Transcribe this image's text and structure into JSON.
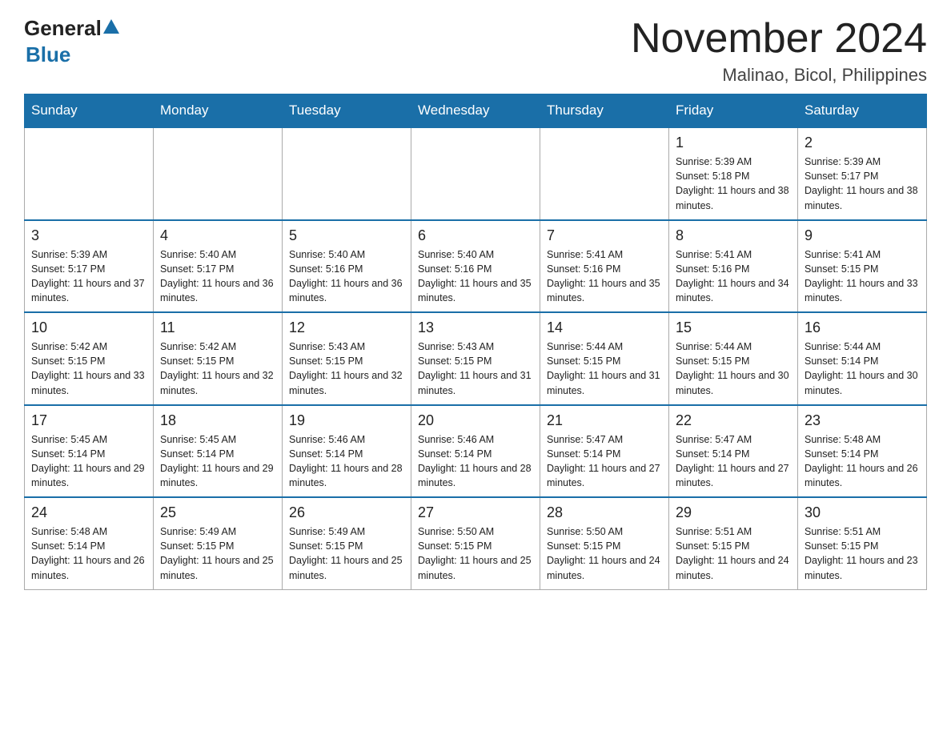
{
  "logo": {
    "general": "General",
    "blue": "Blue"
  },
  "title": "November 2024",
  "location": "Malinao, Bicol, Philippines",
  "days_of_week": [
    "Sunday",
    "Monday",
    "Tuesday",
    "Wednesday",
    "Thursday",
    "Friday",
    "Saturday"
  ],
  "weeks": [
    [
      {
        "day": "",
        "info": "",
        "empty": true
      },
      {
        "day": "",
        "info": "",
        "empty": true
      },
      {
        "day": "",
        "info": "",
        "empty": true
      },
      {
        "day": "",
        "info": "",
        "empty": true
      },
      {
        "day": "",
        "info": "",
        "empty": true
      },
      {
        "day": "1",
        "info": "Sunrise: 5:39 AM\nSunset: 5:18 PM\nDaylight: 11 hours and 38 minutes."
      },
      {
        "day": "2",
        "info": "Sunrise: 5:39 AM\nSunset: 5:17 PM\nDaylight: 11 hours and 38 minutes."
      }
    ],
    [
      {
        "day": "3",
        "info": "Sunrise: 5:39 AM\nSunset: 5:17 PM\nDaylight: 11 hours and 37 minutes."
      },
      {
        "day": "4",
        "info": "Sunrise: 5:40 AM\nSunset: 5:17 PM\nDaylight: 11 hours and 36 minutes."
      },
      {
        "day": "5",
        "info": "Sunrise: 5:40 AM\nSunset: 5:16 PM\nDaylight: 11 hours and 36 minutes."
      },
      {
        "day": "6",
        "info": "Sunrise: 5:40 AM\nSunset: 5:16 PM\nDaylight: 11 hours and 35 minutes."
      },
      {
        "day": "7",
        "info": "Sunrise: 5:41 AM\nSunset: 5:16 PM\nDaylight: 11 hours and 35 minutes."
      },
      {
        "day": "8",
        "info": "Sunrise: 5:41 AM\nSunset: 5:16 PM\nDaylight: 11 hours and 34 minutes."
      },
      {
        "day": "9",
        "info": "Sunrise: 5:41 AM\nSunset: 5:15 PM\nDaylight: 11 hours and 33 minutes."
      }
    ],
    [
      {
        "day": "10",
        "info": "Sunrise: 5:42 AM\nSunset: 5:15 PM\nDaylight: 11 hours and 33 minutes."
      },
      {
        "day": "11",
        "info": "Sunrise: 5:42 AM\nSunset: 5:15 PM\nDaylight: 11 hours and 32 minutes."
      },
      {
        "day": "12",
        "info": "Sunrise: 5:43 AM\nSunset: 5:15 PM\nDaylight: 11 hours and 32 minutes."
      },
      {
        "day": "13",
        "info": "Sunrise: 5:43 AM\nSunset: 5:15 PM\nDaylight: 11 hours and 31 minutes."
      },
      {
        "day": "14",
        "info": "Sunrise: 5:44 AM\nSunset: 5:15 PM\nDaylight: 11 hours and 31 minutes."
      },
      {
        "day": "15",
        "info": "Sunrise: 5:44 AM\nSunset: 5:15 PM\nDaylight: 11 hours and 30 minutes."
      },
      {
        "day": "16",
        "info": "Sunrise: 5:44 AM\nSunset: 5:14 PM\nDaylight: 11 hours and 30 minutes."
      }
    ],
    [
      {
        "day": "17",
        "info": "Sunrise: 5:45 AM\nSunset: 5:14 PM\nDaylight: 11 hours and 29 minutes."
      },
      {
        "day": "18",
        "info": "Sunrise: 5:45 AM\nSunset: 5:14 PM\nDaylight: 11 hours and 29 minutes."
      },
      {
        "day": "19",
        "info": "Sunrise: 5:46 AM\nSunset: 5:14 PM\nDaylight: 11 hours and 28 minutes."
      },
      {
        "day": "20",
        "info": "Sunrise: 5:46 AM\nSunset: 5:14 PM\nDaylight: 11 hours and 28 minutes."
      },
      {
        "day": "21",
        "info": "Sunrise: 5:47 AM\nSunset: 5:14 PM\nDaylight: 11 hours and 27 minutes."
      },
      {
        "day": "22",
        "info": "Sunrise: 5:47 AM\nSunset: 5:14 PM\nDaylight: 11 hours and 27 minutes."
      },
      {
        "day": "23",
        "info": "Sunrise: 5:48 AM\nSunset: 5:14 PM\nDaylight: 11 hours and 26 minutes."
      }
    ],
    [
      {
        "day": "24",
        "info": "Sunrise: 5:48 AM\nSunset: 5:14 PM\nDaylight: 11 hours and 26 minutes."
      },
      {
        "day": "25",
        "info": "Sunrise: 5:49 AM\nSunset: 5:15 PM\nDaylight: 11 hours and 25 minutes."
      },
      {
        "day": "26",
        "info": "Sunrise: 5:49 AM\nSunset: 5:15 PM\nDaylight: 11 hours and 25 minutes."
      },
      {
        "day": "27",
        "info": "Sunrise: 5:50 AM\nSunset: 5:15 PM\nDaylight: 11 hours and 25 minutes."
      },
      {
        "day": "28",
        "info": "Sunrise: 5:50 AM\nSunset: 5:15 PM\nDaylight: 11 hours and 24 minutes."
      },
      {
        "day": "29",
        "info": "Sunrise: 5:51 AM\nSunset: 5:15 PM\nDaylight: 11 hours and 24 minutes."
      },
      {
        "day": "30",
        "info": "Sunrise: 5:51 AM\nSunset: 5:15 PM\nDaylight: 11 hours and 23 minutes."
      }
    ]
  ]
}
